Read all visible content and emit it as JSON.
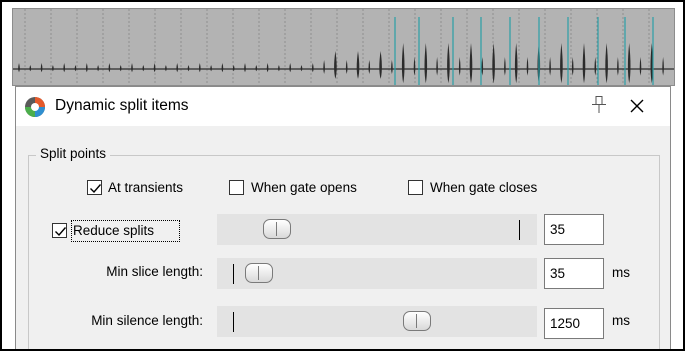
{
  "dialog": {
    "title": "Dynamic split items",
    "icons": {
      "app": "reaper-logo-icon",
      "pin": "pin-icon",
      "close": "close-icon"
    }
  },
  "split_points": {
    "group_label": "Split points",
    "at_transients": {
      "label": "At transients",
      "checked": true
    },
    "when_gate_opens": {
      "label": "When gate opens",
      "checked": false
    },
    "when_gate_closes": {
      "label": "When gate closes",
      "checked": false
    }
  },
  "reduce_splits": {
    "label": "Reduce splits",
    "checked": true,
    "value": "35",
    "slider_fraction": 0.1
  },
  "min_slice_length": {
    "label": "Min slice length:",
    "value": "35",
    "unit": "ms",
    "slider_fraction": 0.03
  },
  "min_silence_length": {
    "label": "Min silence length:",
    "value": "1250",
    "unit": "ms",
    "slider_fraction": 0.64
  },
  "colors": {
    "waveform": "#2b2b2b",
    "split_marker": "#2a9fa6",
    "track_bg": "#b3b3b3"
  }
}
